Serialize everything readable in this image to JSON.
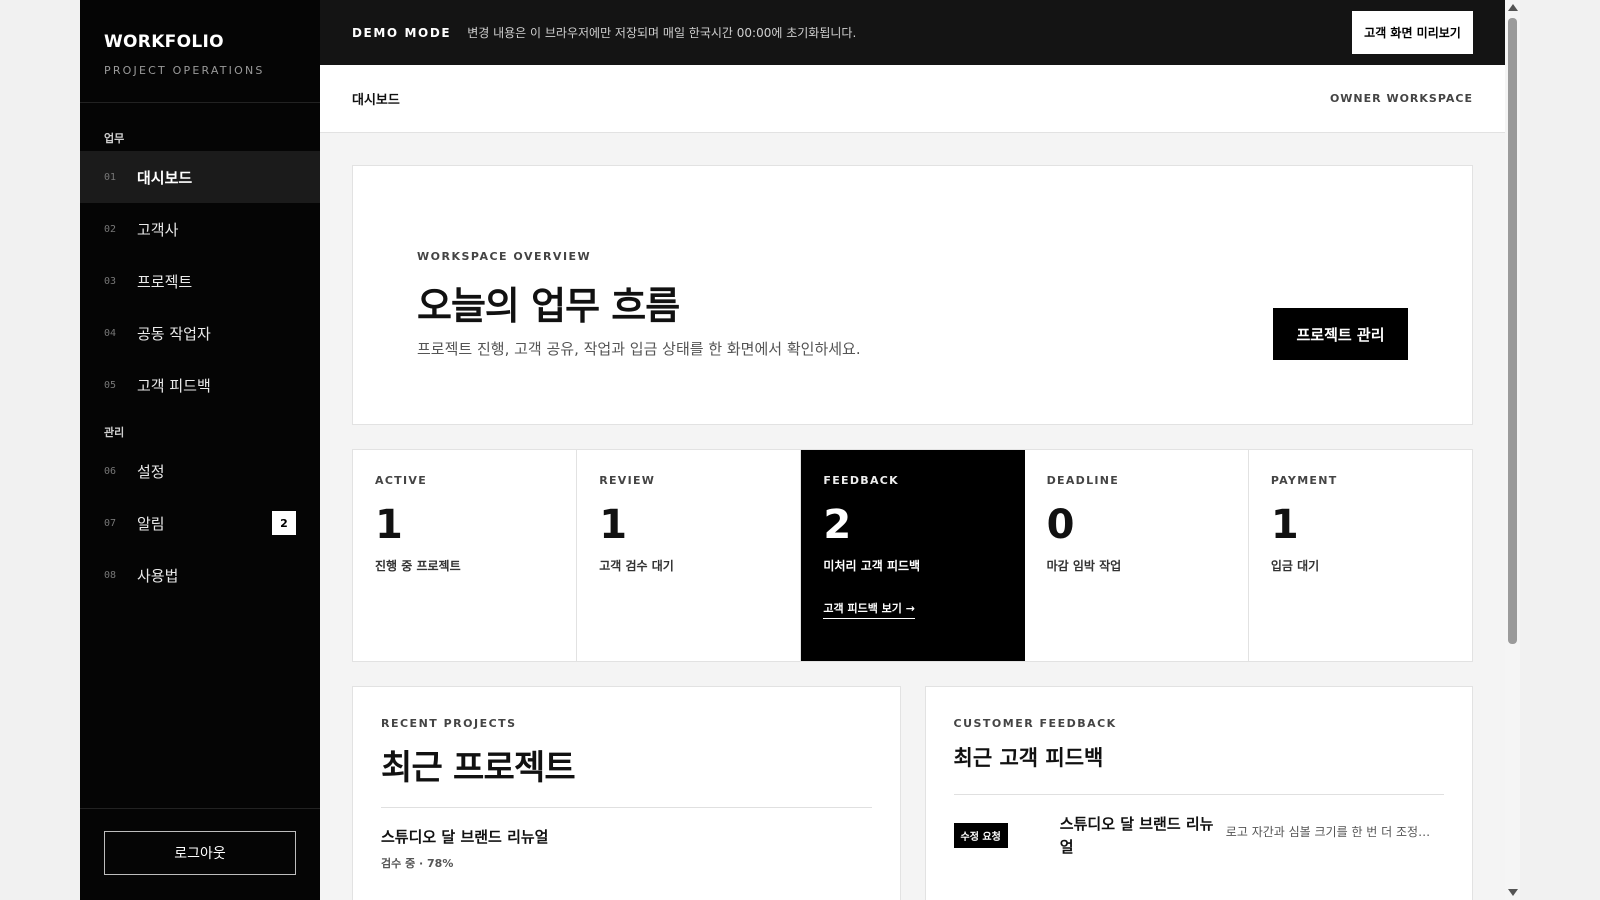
{
  "brand": {
    "name": "WORKFOLIO",
    "subtitle": "PROJECT OPERATIONS"
  },
  "sidebar": {
    "section_work": "업무",
    "section_admin": "관리",
    "items": [
      {
        "num": "01",
        "label": "대시보드"
      },
      {
        "num": "02",
        "label": "고객사"
      },
      {
        "num": "03",
        "label": "프로젝트"
      },
      {
        "num": "04",
        "label": "공동 작업자"
      },
      {
        "num": "05",
        "label": "고객 피드백"
      },
      {
        "num": "06",
        "label": "설정"
      },
      {
        "num": "07",
        "label": "알림",
        "badge": "2"
      },
      {
        "num": "08",
        "label": "사용법"
      }
    ],
    "logout_label": "로그아웃"
  },
  "demo_bar": {
    "tag": "DEMO MODE",
    "text": "변경 내용은 이 브라우저에만 저장되며 매일 한국시간 00:00에 초기화됩니다.",
    "preview_label": "고객 화면 미리보기"
  },
  "header": {
    "breadcrumb": "대시보드",
    "workspace": "OWNER WORKSPACE"
  },
  "hero": {
    "eyebrow": "WORKSPACE OVERVIEW",
    "title": "오늘의 업무 흐름",
    "description": "프로젝트 진행, 고객 공유, 작업과 입금 상태를 한 화면에서 확인하세요.",
    "button_label": "프로젝트 관리"
  },
  "stats": [
    {
      "label": "ACTIVE",
      "value": "1",
      "desc": "진행 중 프로젝트"
    },
    {
      "label": "REVIEW",
      "value": "1",
      "desc": "고객 검수 대기"
    },
    {
      "label": "FEEDBACK",
      "value": "2",
      "desc": "미처리 고객 피드백",
      "link": "고객 피드백 보기 →"
    },
    {
      "label": "DEADLINE",
      "value": "0",
      "desc": "마감 임박 작업"
    },
    {
      "label": "PAYMENT",
      "value": "1",
      "desc": "입금 대기"
    }
  ],
  "recent_projects": {
    "eyebrow": "RECENT PROJECTS",
    "title": "최근 프로젝트",
    "items": [
      {
        "name": "스튜디오 달 브랜드 리뉴얼",
        "meta": "검수 중 · 78%"
      }
    ]
  },
  "customer_feedback": {
    "eyebrow": "CUSTOMER FEEDBACK",
    "title": "최근 고객 피드백",
    "items": [
      {
        "badge": "수정 요청",
        "project": "스튜디오 달 브랜드 리뉴얼",
        "text": "로고 자간과 심볼 크기를 한 번 더 조정…"
      }
    ]
  }
}
